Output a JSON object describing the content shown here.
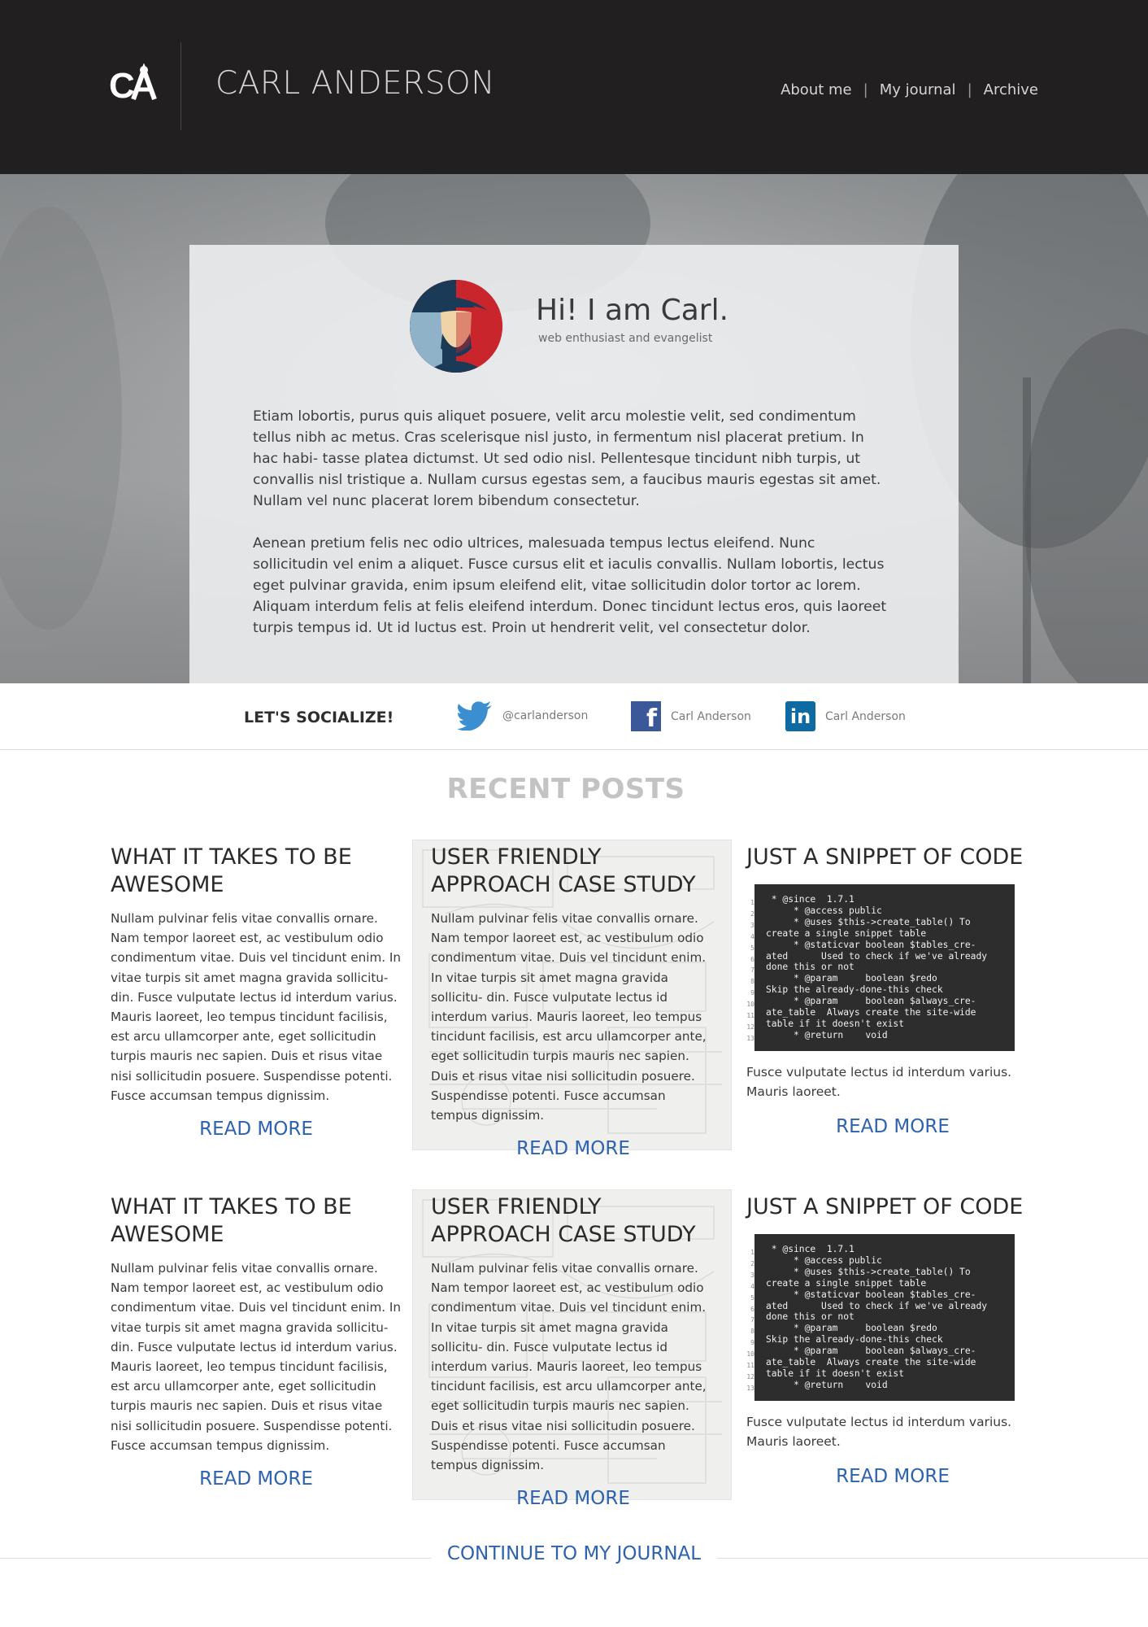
{
  "header": {
    "logo_text": "CA",
    "site_title": "CARL ANDERSON",
    "nav": [
      {
        "label": "About me"
      },
      {
        "label": "My journal"
      },
      {
        "label": "Archive"
      }
    ],
    "nav_separator": "|"
  },
  "intro": {
    "greeting": "Hi! I am Carl.",
    "tagline": "web enthusiast and evangelist",
    "paragraphs": [
      "Etiam lobortis, purus quis aliquet posuere, velit arcu molestie velit, sed condimentum tellus nibh ac metus. Cras scelerisque nisl justo, in fermentum nisl placerat pretium. In hac habi- tasse platea dictumst. Ut sed odio nisl. Pellentesque tincidunt nibh turpis, ut convallis nisl tristique a. Nullam cursus egestas sem, a faucibus mauris egestas sit amet. Nullam vel nunc placerat lorem bibendum consectetur.",
      "Aenean pretium felis nec odio ultrices, malesuada tempus lectus eleifend. Nunc sollicitudin vel enim a aliquet. Fusce cursus elit et iaculis convallis. Nullam lobortis, lectus eget pulvinar gravida, enim ipsum eleifend elit, vitae sollicitudin dolor tortor ac lorem. Aliquam interdum felis at felis eleifend interdum. Donec tincidunt lectus eros, quis laoreet turpis tempus id. Ut id luctus est. Proin ut hendrerit velit, vel consectetur dolor."
    ]
  },
  "social": {
    "title": "LET'S SOCIALIZE!",
    "items": [
      {
        "icon": "twitter-icon",
        "label": "@carlanderson"
      },
      {
        "icon": "facebook-icon",
        "glyph": "f",
        "label": "Carl Anderson"
      },
      {
        "icon": "linkedin-icon",
        "glyph": "in",
        "label": "Carl Anderson"
      }
    ]
  },
  "recent_posts": {
    "title": "RECENT POSTS",
    "read_more": "READ MORE",
    "rows": [
      {
        "awesome": {
          "title": "WHAT IT TAKES TO BE AWESOME",
          "body": "Nullam pulvinar felis vitae convallis ornare. Nam tempor laoreet est, ac vestibulum odio condimentum vitae. Duis vel tincidunt enim. In vitae turpis sit amet magna gravida sollicitu- din. Fusce vulputate lectus id interdum varius. Mauris laoreet, leo tempus tincidunt facilisis, est arcu ullamcorper ante, eget sollicitudin turpis mauris nec sapien. Duis et risus vitae nisi sollicitudin posuere. Suspendisse potenti. Fusce accumsan tempus dignissim."
        },
        "case_study": {
          "title": "USER FRIENDLY APPROACH CASE STUDY",
          "body": "Nullam pulvinar felis vitae convallis ornare. Nam tempor laoreet est, ac vestibulum odio condimentum vitae. Duis vel tincidunt enim. In vitae turpis sit amet magna gravida sollicitu- din. Fusce vulputate lectus id interdum varius. Mauris laoreet, leo tempus tincidunt facilisis, est arcu ullamcorper ante, eget sollicitudin turpis mauris nec sapien. Duis et risus vitae nisi sollicitudin posuere. Suspendisse potenti. Fusce accumsan tempus dignissim."
        },
        "snippet": {
          "title": "JUST A SNIPPET OF CODE",
          "gutter": "1\n2\n3\n4\n5\n6\n7\n8\n9\n10\n11\n12\n13",
          "code": " * @since  1.7.1\n     * @access public\n     * @uses $this->create_table() To\ncreate a single snippet table\n     * @staticvar boolean $tables_cre-\nated      Used to check if we've already\ndone this or not\n     * @param     boolean $redo\nSkip the already-done-this check\n     * @param     boolean $always_cre-\nate_table  Always create the site-wide\ntable if it doesn't exist\n     * @return    void",
          "after": "Fusce vulputate lectus id interdum varius. Mauris laoreet."
        }
      },
      {
        "awesome": {
          "title": "WHAT IT TAKES TO BE AWESOME",
          "body": "Nullam pulvinar felis vitae convallis ornare. Nam tempor laoreet est, ac vestibulum odio condimentum vitae. Duis vel tincidunt enim. In vitae turpis sit amet magna gravida sollicitu- din. Fusce vulputate lectus id interdum varius. Mauris laoreet, leo tempus tincidunt facilisis, est arcu ullamcorper ante, eget sollicitudin turpis mauris nec sapien. Duis et risus vitae nisi sollicitudin posuere. Suspendisse potenti. Fusce accumsan tempus dignissim."
        },
        "case_study": {
          "title": "USER FRIENDLY APPROACH CASE STUDY",
          "body": "Nullam pulvinar felis vitae convallis ornare. Nam tempor laoreet est, ac vestibulum odio condimentum vitae. Duis vel tincidunt enim. In vitae turpis sit amet magna gravida sollicitu- din. Fusce vulputate lectus id interdum varius. Mauris laoreet, leo tempus tincidunt facilisis, est arcu ullamcorper ante, eget sollicitudin turpis mauris nec sapien. Duis et risus vitae nisi sollicitudin posuere. Suspendisse potenti. Fusce accumsan tempus dignissim."
        },
        "snippet": {
          "title": "JUST A SNIPPET OF CODE",
          "gutter": "1\n2\n3\n4\n5\n6\n7\n8\n9\n10\n11\n12\n13",
          "code": " * @since  1.7.1\n     * @access public\n     * @uses $this->create_table() To\ncreate a single snippet table\n     * @staticvar boolean $tables_cre-\nated      Used to check if we've already\ndone this or not\n     * @param     boolean $redo\nSkip the already-done-this check\n     * @param     boolean $always_cre-\nate_table  Always create the site-wide\ntable if it doesn't exist\n     * @return    void",
          "after": "Fusce vulputate lectus id interdum varius. Mauris laoreet."
        }
      }
    ]
  },
  "footer": {
    "continue_label": "CONTINUE TO MY JOURNAL"
  },
  "colors": {
    "header_bg": "#221f20",
    "link_blue": "#2d62b0",
    "muted_title": "#c3c3c3"
  }
}
